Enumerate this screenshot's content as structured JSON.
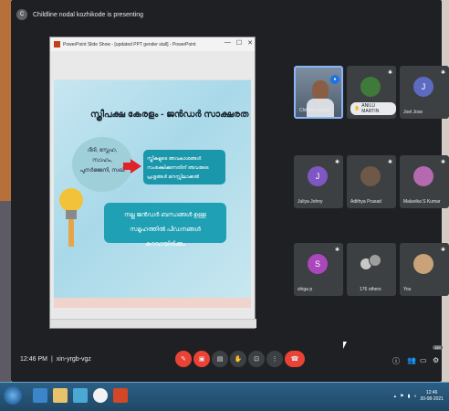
{
  "presenting_banner": {
    "avatar_letter": "C",
    "text": "Childline nodal kozhikode is presenting"
  },
  "ppt_window": {
    "title": "PowerPoint Slide Show - [updated PPT gender stall] - PowerPoint",
    "controls": {
      "minimize": "—",
      "maximize": "☐",
      "close": "✕"
    },
    "slide": {
      "title": "സ്ത്രീപക്ഷ കേരളം - ജൻഡർ സാക്ഷരത",
      "bubble_text": "ദീദി, സ്നേഹ, സാഹം, പുനർജ്ജനി, സഖി",
      "box1_text": "സ്ത്രീകളുടെ അവകാശങ്ങൾ സംരക്ഷിക്കുന്നതിന് അവരുടെ പ്രശ്നങ്ങൾ മനസ്സിലാക്കൽ",
      "box2_text": "നല്ല ജൻഡർ ബന്ധങ്ങൾ ഉള്ള സമൂഹത്തിൽ പീഡനങ്ങൾ കുറവായിരിക്കും"
    }
  },
  "participants": [
    {
      "name": "Childline Nodal",
      "type": "presenter"
    },
    {
      "name": "ANILU MARTIN",
      "type": "badge"
    },
    {
      "name": "Joel Jose",
      "letter": "J",
      "color": "#5c6bc0",
      "type": "avatar"
    },
    {
      "name": "Juliya Johny",
      "letter": "J",
      "color": "#7e57c2",
      "type": "avatar"
    },
    {
      "name": "Adithya Prasad",
      "type": "photo"
    },
    {
      "name": "Malavika S Kumar",
      "type": "photo"
    },
    {
      "name": "shiga p",
      "letter": "S",
      "color": "#ab47bc",
      "type": "avatar"
    },
    {
      "name": "176 others",
      "type": "others"
    },
    {
      "name": "You",
      "type": "photo"
    }
  ],
  "bottom_bar": {
    "time": "12:46 PM",
    "separator": "|",
    "meeting_code": "xin-yrgb-vgz",
    "participant_count": "189"
  },
  "taskbar": {
    "clock_time": "12:46",
    "clock_date": "30-08-2021"
  },
  "colors": {
    "screen_bg": "#1f2023",
    "tile_bg": "#3c4043",
    "end_call": "#ea4335",
    "accent": "#1a73e8"
  }
}
